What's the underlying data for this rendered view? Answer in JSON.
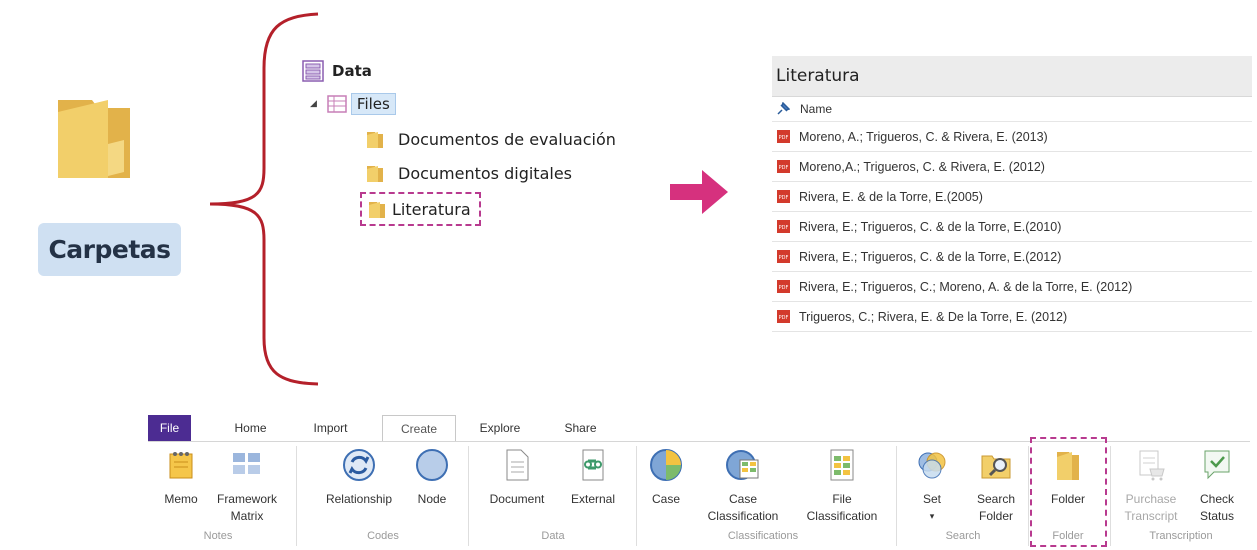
{
  "concept": {
    "label": "Carpetas"
  },
  "tree": {
    "root": "Data",
    "files": "Files",
    "folders": [
      "Documentos de evaluación",
      "Documentos digitales",
      "Literatura"
    ]
  },
  "panel": {
    "title": "Literatura",
    "column": "Name",
    "items": [
      "Moreno, A.; Trigueros, C. & Rivera, E. (2013)",
      "Moreno,A.; Trigueros, C. & Rivera, E. (2012)",
      "Rivera, E. & de la Torre, E.(2005)",
      "Rivera, E.; Trigueros, C. & de la Torre, E.(2010)",
      "Rivera, E.; Trigueros, C. & de la Torre, E.(2012)",
      "Rivera, E.; Trigueros, C.; Moreno, A. & de la Torre, E. (2012)",
      "Trigueros, C.; Rivera, E. & De la Torre, E. (2012)"
    ]
  },
  "ribbon": {
    "tabs": [
      "File",
      "Home",
      "Import",
      "Create",
      "Explore",
      "Share"
    ],
    "active_tab": "Create",
    "buttons": {
      "memo": "Memo",
      "framework_1": "Framework",
      "framework_2": "Matrix",
      "relationship": "Relationship",
      "node": "Node",
      "document": "Document",
      "external": "External",
      "case": "Case",
      "case_class_1": "Case",
      "case_class_2": "Classification",
      "file_class_1": "File",
      "file_class_2": "Classification",
      "set": "Set",
      "set_arrow": "▾",
      "search_folder_1": "Search",
      "search_folder_2": "Folder",
      "folder": "Folder",
      "purchase_1": "Purchase",
      "purchase_2": "Transcript",
      "check_1": "Check",
      "check_2": "Status"
    },
    "groups": {
      "notes": "Notes",
      "codes": "Codes",
      "data": "Data",
      "classifications": "Classifications",
      "search": "Search",
      "folder": "Folder",
      "transcription": "Transcription"
    }
  },
  "colors": {
    "folder": "#e8c25c",
    "highlight": "#b83a8f",
    "arrow": "#d6317e",
    "brace": "#b4202a",
    "file_tab": "#4c2c92"
  }
}
